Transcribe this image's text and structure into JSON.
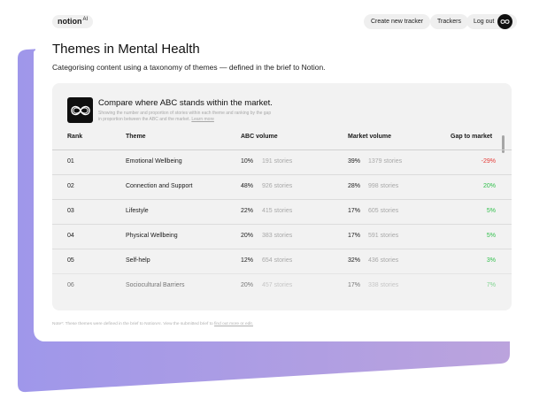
{
  "topbar": {
    "logo_text": "notion",
    "logo_suffix": "AI",
    "create_label": "Create new tracker",
    "trackers_label": "Trackers",
    "logout_label": "Log out"
  },
  "header": {
    "title": "Themes in Mental Health",
    "subtitle": "Categorising content using a taxonomy of themes — defined in the brief to Notion."
  },
  "card": {
    "title": "Compare where ABC stands within the market.",
    "description": "Showing the number and proportion of stories within each theme and ranking by the gap in proportion between the ABC and the market.",
    "learn_more": "Learn more",
    "columns": {
      "rank": "Rank",
      "theme": "Theme",
      "abc": "ABC volume",
      "market": "Market volume",
      "gap": "Gap to market"
    },
    "rows": [
      {
        "rank": "01",
        "theme": "Emotional Wellbeing",
        "abc_pct": "10%",
        "abc_stories": "191 stories",
        "mkt_pct": "39%",
        "mkt_stories": "1379 stories",
        "gap": "-29%"
      },
      {
        "rank": "02",
        "theme": "Connection and Support",
        "abc_pct": "48%",
        "abc_stories": "926 stories",
        "mkt_pct": "28%",
        "mkt_stories": "998 stories",
        "gap": "20%"
      },
      {
        "rank": "03",
        "theme": "Lifestyle",
        "abc_pct": "22%",
        "abc_stories": "415 stories",
        "mkt_pct": "17%",
        "mkt_stories": "605 stories",
        "gap": "5%"
      },
      {
        "rank": "04",
        "theme": "Physical Wellbeing",
        "abc_pct": "20%",
        "abc_stories": "383 stories",
        "mkt_pct": "17%",
        "mkt_stories": "591 stories",
        "gap": "5%"
      },
      {
        "rank": "05",
        "theme": "Self-help",
        "abc_pct": "12%",
        "abc_stories": "654 stories",
        "mkt_pct": "32%",
        "mkt_stories": "436 stories",
        "gap": "3%"
      },
      {
        "rank": "06",
        "theme": "Sociocultural Barriers",
        "abc_pct": "20%",
        "abc_stories": "457 stories",
        "mkt_pct": "17%",
        "mkt_stories": "338 stories",
        "gap": "7%"
      }
    ]
  },
  "note": {
    "text": "Note*: These themes were defined in the brief to NotionAI. View the submitted brief to ",
    "link": "find out more or edit."
  },
  "colors": {
    "purple": "#a69be9",
    "negative": "#e53935",
    "positive": "#2fbf4a"
  }
}
